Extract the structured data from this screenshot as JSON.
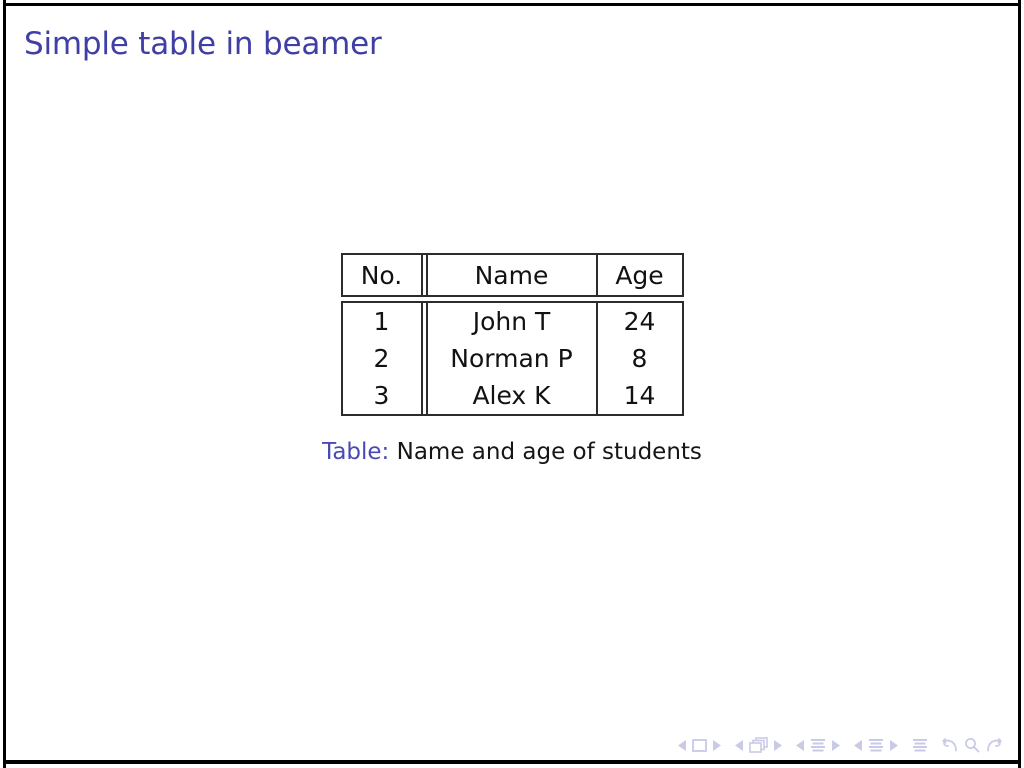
{
  "slide": {
    "title": "Simple table in beamer",
    "background_color": "#ffffff",
    "border_color": "#000000",
    "title_color": "#3f3fa5",
    "caption_label_color": "#4a4ab4",
    "nav_color": "#c9c9e8"
  },
  "table": {
    "columns": [
      "No.",
      "Name",
      "Age"
    ],
    "rows": [
      {
        "no": "1",
        "name": "John T",
        "age": "24"
      },
      {
        "no": "2",
        "name": "Norman P",
        "age": "8"
      },
      {
        "no": "3",
        "name": "Alex K",
        "age": "14"
      }
    ],
    "caption_label": "Table:",
    "caption_text": "Name and age of students"
  },
  "navigation": {
    "items": [
      {
        "name": "slide-prev",
        "icon": "triangle-left-icon"
      },
      {
        "name": "slide-marker",
        "icon": "square-icon"
      },
      {
        "name": "slide-next",
        "icon": "triangle-right-icon"
      },
      {
        "name": "frame-prev",
        "icon": "triangle-left-icon"
      },
      {
        "name": "frame-marker",
        "icon": "stacked-frames-icon"
      },
      {
        "name": "frame-next",
        "icon": "triangle-right-icon"
      },
      {
        "name": "subsection-prev",
        "icon": "triangle-left-icon"
      },
      {
        "name": "subsection-marker",
        "icon": "lines-icon"
      },
      {
        "name": "subsection-next",
        "icon": "triangle-right-icon"
      },
      {
        "name": "section-prev",
        "icon": "triangle-left-icon"
      },
      {
        "name": "section-marker",
        "icon": "lines-icon"
      },
      {
        "name": "section-next",
        "icon": "triangle-right-icon"
      },
      {
        "name": "document-marker",
        "icon": "lines-icon"
      },
      {
        "name": "back-button",
        "icon": "undo-arrow-icon"
      },
      {
        "name": "search-button",
        "icon": "magnifier-icon"
      },
      {
        "name": "forward-button",
        "icon": "redo-arrow-icon"
      }
    ]
  }
}
